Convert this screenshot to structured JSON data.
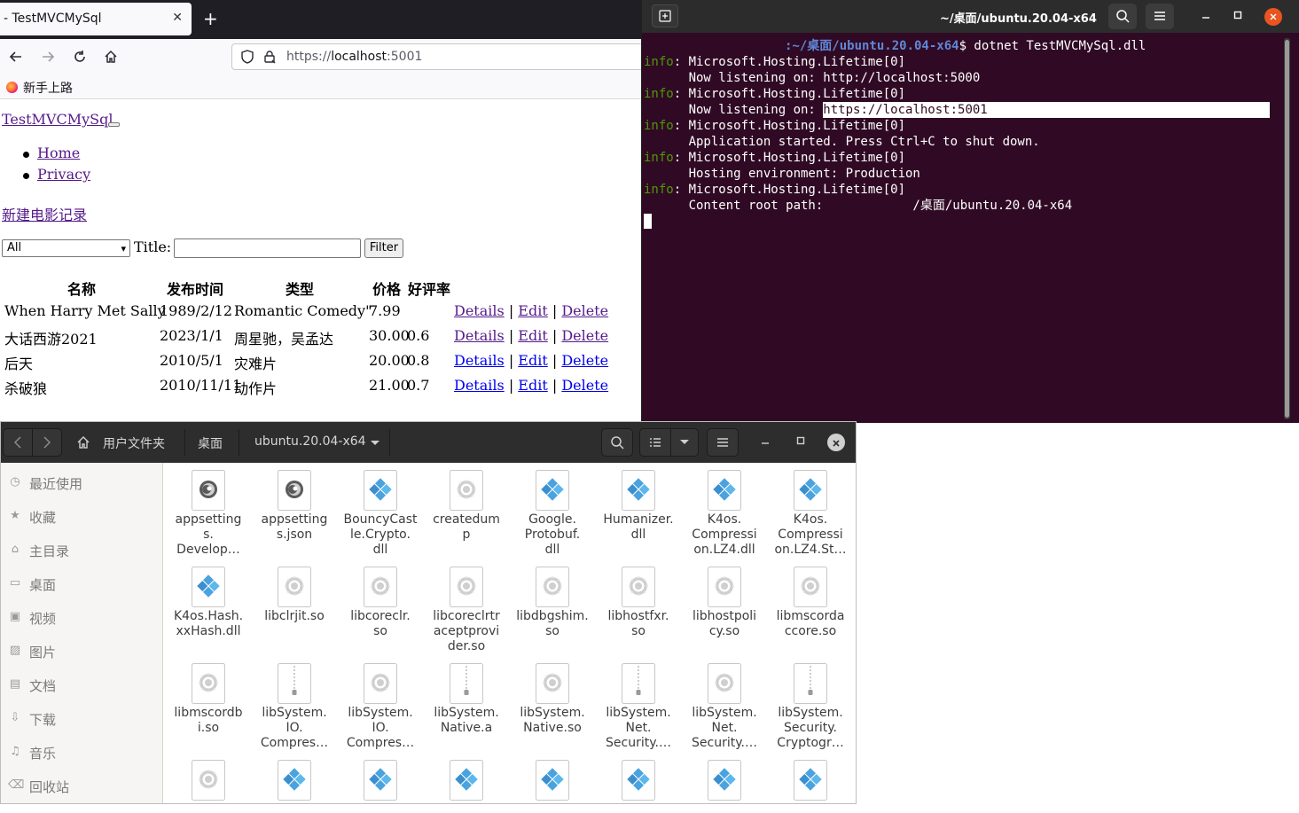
{
  "browser": {
    "tab_title": "- TestMVCMySql",
    "tab_close": "✕",
    "new_tab": "+",
    "url_scheme": "https://",
    "url_host": "localhost",
    "url_port": ":5001",
    "bookmark": "新手上路",
    "page": {
      "brand": "TestMVCMySql",
      "nav": [
        "Home",
        "Privacy"
      ],
      "create_link": "新建电影记录",
      "genre_selected": "All",
      "title_label": "Title:",
      "title_value": "",
      "filter_button": "Filter",
      "table": {
        "headers": [
          "名称",
          "发布时间",
          "类型",
          "价格",
          "好评率"
        ],
        "rows": [
          {
            "name": "When Harry Met Sally",
            "date": "1989/2/12",
            "genre": "Romantic Comedy\"",
            "price": "7.99",
            "rating": ""
          },
          {
            "name": "大话西游2021",
            "date": "2023/1/1",
            "genre": "周星驰，吴孟达",
            "price": "30.00",
            "rating": "0.6"
          },
          {
            "name": "后天",
            "date": "2010/5/1",
            "genre": "灾难片",
            "price": "20.00",
            "rating": "0.8"
          },
          {
            "name": "杀破狼",
            "date": "2010/11/11",
            "genre": "动作片",
            "price": "21.00",
            "rating": "0.7"
          }
        ],
        "actions": [
          "Details",
          "Edit",
          "Delete"
        ],
        "separator": "|"
      }
    }
  },
  "terminal": {
    "title": "~/桌面/ubuntu.20.04-x64",
    "prompt_path": ":~/桌面/ubuntu.20.04-x64",
    "command": "$ dotnet TestMVCMySql.dll",
    "info_tag": "info",
    "lines": [
      {
        "kind": "info",
        "text": ": Microsoft.Hosting.Lifetime[0]"
      },
      {
        "kind": "plain",
        "text": "      Now listening on: http://localhost:5000"
      },
      {
        "kind": "info",
        "text": ": Microsoft.Hosting.Lifetime[0]"
      },
      {
        "kind": "plain",
        "text": "      Now listening on: ",
        "highlight": "https://localhost:5001"
      },
      {
        "kind": "info",
        "text": ": Microsoft.Hosting.Lifetime[0]"
      },
      {
        "kind": "plain",
        "text": "      Application started. Press Ctrl+C to shut down."
      },
      {
        "kind": "info",
        "text": ": Microsoft.Hosting.Lifetime[0]"
      },
      {
        "kind": "plain",
        "text": "      Hosting environment: Production"
      },
      {
        "kind": "info",
        "text": ": Microsoft.Hosting.Lifetime[0]"
      },
      {
        "kind": "plain",
        "text": "      Content root path:            /桌面/ubuntu.20.04-x64"
      }
    ]
  },
  "files": {
    "breadcrumbs": [
      "用户文件夹",
      "桌面",
      "ubuntu.20.04-x64"
    ],
    "sidebar": [
      {
        "label": "最近使用",
        "icon": "clock-icon"
      },
      {
        "label": "收藏",
        "icon": "star-icon"
      },
      {
        "label": "主目录",
        "icon": "home-icon"
      },
      {
        "label": "桌面",
        "icon": "desktop-icon"
      },
      {
        "label": "视频",
        "icon": "video-icon"
      },
      {
        "label": "图片",
        "icon": "picture-icon"
      },
      {
        "label": "文档",
        "icon": "document-icon"
      },
      {
        "label": "下载",
        "icon": "download-icon"
      },
      {
        "label": "音乐",
        "icon": "music-icon"
      },
      {
        "label": "回收站",
        "icon": "trash-icon"
      }
    ],
    "items": [
      {
        "name": "appsetting\ns.\nDevelop…",
        "icon": "json-icon"
      },
      {
        "name": "appsetting\ns.json",
        "icon": "json-icon"
      },
      {
        "name": "BouncyCast\nle.Crypto.\ndll",
        "icon": "dll-icon"
      },
      {
        "name": "createdum\np",
        "icon": "executable-icon"
      },
      {
        "name": "Google.\nProtobuf.\ndll",
        "icon": "dll-icon"
      },
      {
        "name": "Humanizer.\ndll",
        "icon": "dll-icon"
      },
      {
        "name": "K4os.\nCompressi\non.LZ4.dll",
        "icon": "dll-icon"
      },
      {
        "name": "K4os.\nCompressi\non.LZ4.St…",
        "icon": "dll-icon"
      },
      {
        "name": "K4os.Hash.\nxxHash.dll",
        "icon": "dll-icon"
      },
      {
        "name": "libclrjit.so",
        "icon": "library-icon"
      },
      {
        "name": "libcoreclr.\nso",
        "icon": "library-icon"
      },
      {
        "name": "libcoreclrtr\naceptprovi\nder.so",
        "icon": "library-icon"
      },
      {
        "name": "libdbgshim.\nso",
        "icon": "library-icon"
      },
      {
        "name": "libhostfxr.\nso",
        "icon": "library-icon"
      },
      {
        "name": "libhostpoli\ncy.so",
        "icon": "library-icon"
      },
      {
        "name": "libmscorda\nccore.so",
        "icon": "library-icon"
      },
      {
        "name": "libmscordb\ni.so",
        "icon": "library-icon"
      },
      {
        "name": "libSystem.\nIO.\nCompres…",
        "icon": "archive-icon"
      },
      {
        "name": "libSystem.\nIO.\nCompres…",
        "icon": "library-icon"
      },
      {
        "name": "libSystem.\nNative.a",
        "icon": "archive-icon"
      },
      {
        "name": "libSystem.\nNative.so",
        "icon": "library-icon"
      },
      {
        "name": "libSystem.\nNet.\nSecurity.…",
        "icon": "archive-icon"
      },
      {
        "name": "libSystem.\nNet.\nSecurity.…",
        "icon": "library-icon"
      },
      {
        "name": "libSystem.\nSecurity.\nCryptogr…",
        "icon": "archive-icon"
      },
      {
        "name": "",
        "icon": "library-icon"
      },
      {
        "name": "",
        "icon": "dll-icon"
      },
      {
        "name": "",
        "icon": "dll-icon"
      },
      {
        "name": "",
        "icon": "dll-icon"
      },
      {
        "name": "",
        "icon": "dll-icon"
      },
      {
        "name": "",
        "icon": "dll-icon"
      },
      {
        "name": "",
        "icon": "dll-icon"
      },
      {
        "name": "",
        "icon": "dll-icon"
      }
    ]
  },
  "colors": {
    "terminal_bg": "#300a24",
    "terminal_info": "#4e9a06",
    "terminal_prompt": "#5f87d7",
    "ubuntu_orange": "#e95420",
    "link_visited": "#551a8b",
    "link": "#0000ee"
  }
}
